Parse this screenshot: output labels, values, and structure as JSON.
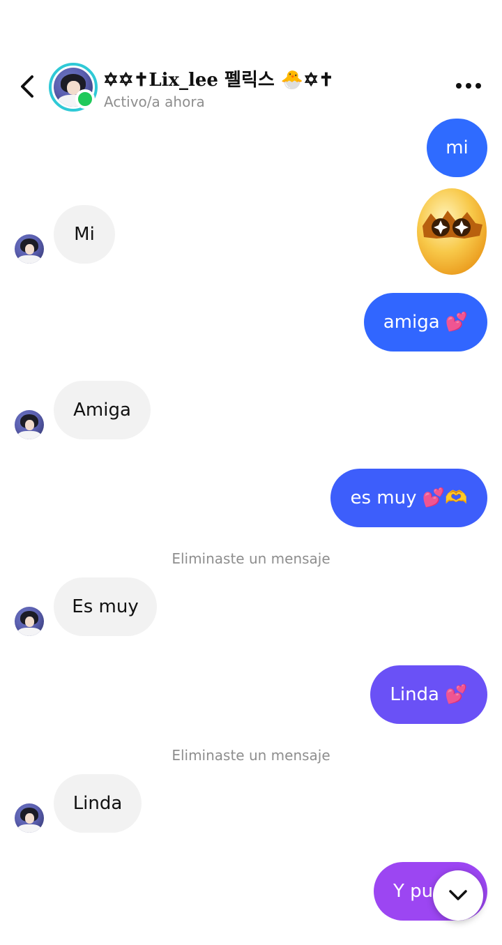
{
  "header": {
    "name": "✡✡✝Lix_lee 펠릭스 🐣✡✝",
    "status": "Activo/a ahora"
  },
  "messages": [
    {
      "side": "out",
      "text": "mi"
    },
    {
      "side": "in",
      "text": "Mi"
    },
    {
      "side": "out",
      "type": "sticker",
      "sticker": "egg-star-eyes-sticker"
    },
    {
      "side": "out",
      "text": "amiga 💕"
    },
    {
      "side": "in",
      "text": "Amiga"
    },
    {
      "side": "out",
      "text": "es muy 💕🫶"
    },
    {
      "side": "system",
      "text": "Eliminaste un mensaje"
    },
    {
      "side": "in",
      "text": "Es muy"
    },
    {
      "side": "out",
      "text": "Linda 💕"
    },
    {
      "side": "system",
      "text": "Eliminaste un mensaje"
    },
    {
      "side": "in",
      "text": "Linda"
    },
    {
      "side": "out",
      "text": "Y pu"
    }
  ],
  "colors": {
    "gradient_top": "#2f6bff",
    "gradient_bottom": "#a855f7",
    "incoming_bubble": "#f2f2f2",
    "online": "#1fc95a",
    "story_ring": "#2fc9d6"
  },
  "icons": {
    "back": "chevron-left-icon",
    "more": "more-dots-icon",
    "scroll_down": "chevron-down-icon"
  }
}
